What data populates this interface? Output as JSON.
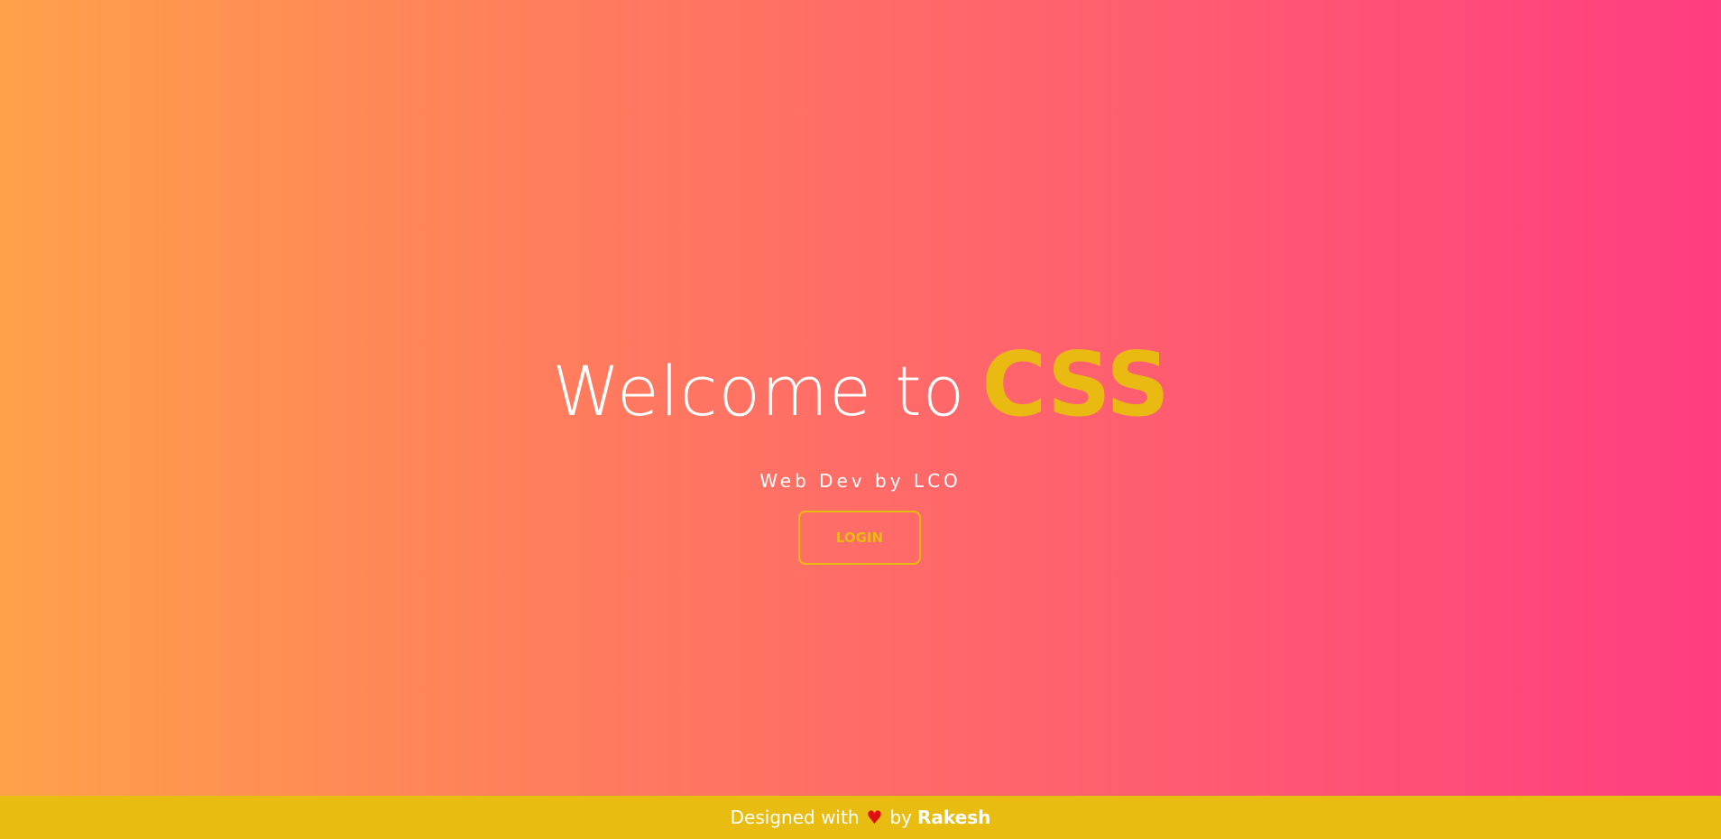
{
  "hero": {
    "title_prefix": "Welcome to",
    "title_accent": "CSS",
    "subtitle": "Web Dev by LCO",
    "login_label": "LOGIN"
  },
  "footer": {
    "text_before": "Designed with",
    "heart_icon": "heart-icon",
    "text_by": "by",
    "author": "Rakesh"
  },
  "colors": {
    "accent": "#e9bb12",
    "gradient_start": "#ffa14a",
    "gradient_end": "#ff3d80",
    "footer_bg": "#e8bc11",
    "heart": "#e01010"
  }
}
